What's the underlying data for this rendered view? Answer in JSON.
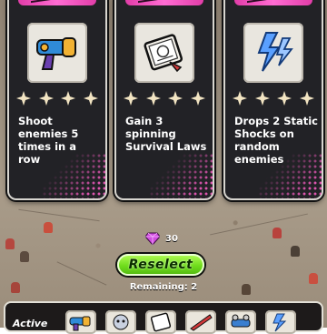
{
  "gems": {
    "count": "30",
    "icon": "gem-icon"
  },
  "reselect": {
    "label": "Reselect"
  },
  "remaining": {
    "label": "Remaining: 2"
  },
  "active_bar": {
    "label": "Active"
  },
  "cards": [
    {
      "icon": "blaster-gun-icon",
      "stars": 4,
      "text": "Shoot enemies 5 times in a row"
    },
    {
      "icon": "book-icon",
      "stars": 4,
      "text": "Gain 3 spinning Survival Laws"
    },
    {
      "icon": "lightning-icon",
      "stars": 4,
      "text": "Drops 2 Static Shocks on random enemies"
    }
  ],
  "colors": {
    "card_top": "#e23da8",
    "button_green": "#6fdc1c",
    "star": "#f2e4c2"
  }
}
